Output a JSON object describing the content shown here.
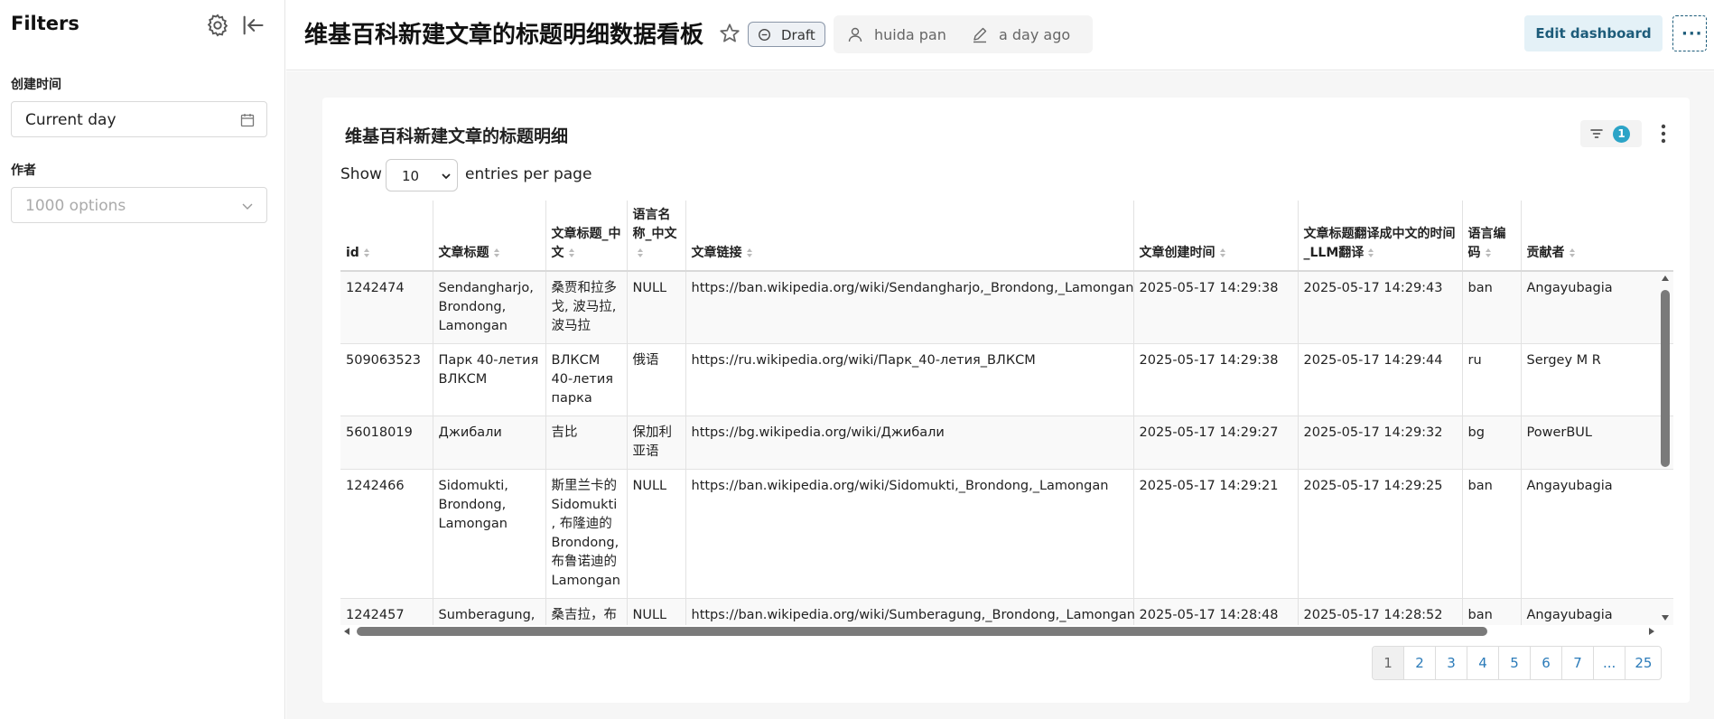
{
  "sidebar": {
    "title": "Filters",
    "filters": [
      {
        "label": "创建时间",
        "value": "Current day",
        "placeholder": ""
      },
      {
        "label": "作者",
        "value": "",
        "placeholder": "1000 options"
      }
    ],
    "icons": [
      "gear-icon",
      "collapse-icon",
      "calendar-icon",
      "chevron-down-icon"
    ]
  },
  "header": {
    "title": "维基百科新建文章的标题明细数据看板",
    "status_badge": "Draft",
    "owner": "huida pan",
    "modified": "a day ago",
    "edit_button": "Edit dashboard",
    "more_button": "···"
  },
  "card": {
    "title": "维基百科新建文章的标题明细",
    "filter_count": "1",
    "entries": {
      "show": "Show",
      "per_page_value": "10",
      "per_page_suffix": "entries per page"
    },
    "columns": [
      {
        "label": "id"
      },
      {
        "label": "文章标题"
      },
      {
        "label": "文章标题_中文"
      },
      {
        "label": "语言名称_中文"
      },
      {
        "label": "文章链接"
      },
      {
        "label": "文章创建时间"
      },
      {
        "label": "文章标题翻译成中文的时间_LLM翻译"
      },
      {
        "label": "语言编码"
      },
      {
        "label": "贡献者"
      }
    ],
    "rows": [
      [
        "1242474",
        "Sendangharjo, Brondong, Lamongan",
        "桑贾和拉多戈, 波马拉, 波马拉",
        "NULL",
        "https://ban.wikipedia.org/wiki/Sendangharjo,_Brondong,_Lamongan",
        "2025-05-17 14:29:38",
        "2025-05-17 14:29:43",
        "ban",
        "Angayubagia"
      ],
      [
        "509063523",
        "Парк 40-летия ВЛКСМ",
        "ВЛКСМ 40-летия парка",
        "俄语",
        "https://ru.wikipedia.org/wiki/Парк_40-летия_ВЛКСМ",
        "2025-05-17 14:29:38",
        "2025-05-17 14:29:44",
        "ru",
        "Sergey M R"
      ],
      [
        "56018019",
        "Джибали",
        "吉比",
        "保加利亚语",
        "https://bg.wikipedia.org/wiki/Джибали",
        "2025-05-17 14:29:27",
        "2025-05-17 14:29:32",
        "bg",
        "PowerBUL"
      ],
      [
        "1242466",
        "Sidomukti, Brondong, Lamongan",
        "斯里兰卡的Sidomukti, 布隆迪的Brondong, 布鲁诺迪的Lamongan",
        "NULL",
        "https://ban.wikipedia.org/wiki/Sidomukti,_Brondong,_Lamongan",
        "2025-05-17 14:29:21",
        "2025-05-17 14:29:25",
        "ban",
        "Angayubagia"
      ],
      [
        "1242457",
        "Sumberagung, Brondong, Lamongan",
        "桑吉拉，布朗迪，拉莫",
        "NULL",
        "https://ban.wikipedia.org/wiki/Sumberagung,_Brondong,_Lamongan",
        "2025-05-17 14:28:48",
        "2025-05-17 14:28:52",
        "ban",
        "Angayubagia"
      ]
    ],
    "pagination": [
      "1",
      "2",
      "3",
      "4",
      "5",
      "6",
      "7",
      "...",
      "25"
    ],
    "active_page": "1"
  }
}
